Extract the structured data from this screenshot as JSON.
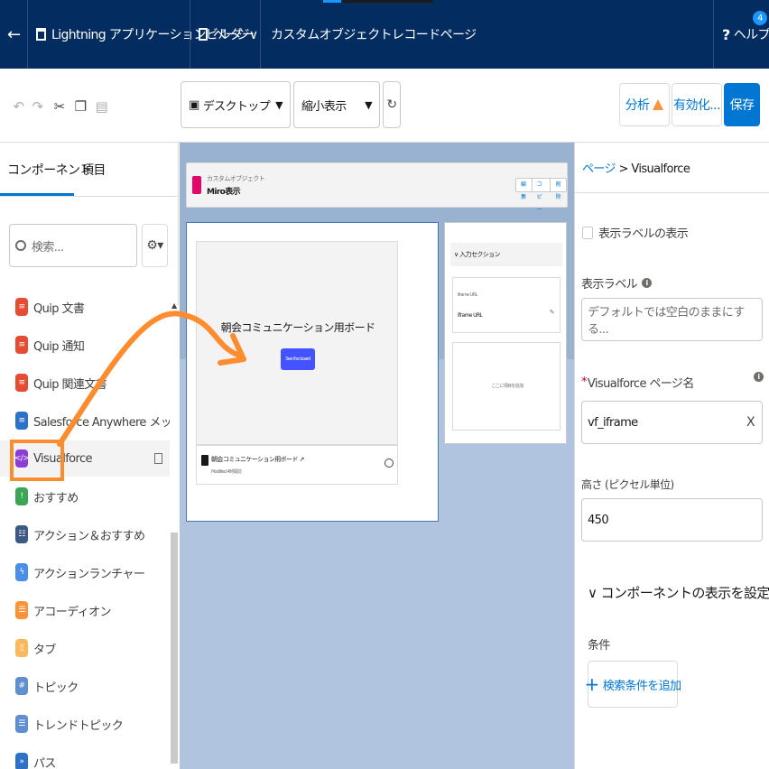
{
  "topbar": {
    "back_icon": "←",
    "builder_title": "Lightning アプリケーションビルダー",
    "pages_label": "ページ∨",
    "page_name": "カスタムオブジェクトレコードページ",
    "help_icon": "?",
    "help_label": "ヘルプ",
    "help_badge": "4"
  },
  "toolbar": {
    "undo_icon": "↶",
    "redo_icon": "↷",
    "cut_icon": "✂",
    "copy_icon": "❐",
    "paste_icon": "▤",
    "device_select": "デスクトップ",
    "device_icon": "▣",
    "view_select": "縮小表示",
    "refresh_icon": "↻",
    "analyze_label": "分析",
    "activate_label": "有効化...",
    "save_label": "保存"
  },
  "left_panel": {
    "tab_components": "コンポーネント",
    "tab_fields": "項目",
    "search_placeholder": "検索...",
    "gear_icon": "⚙▾",
    "scroll_up_icon": "▲",
    "components": [
      {
        "label": "Quip 文書",
        "icon": "quip-icon",
        "color": "#e44c34",
        "glyph": "≡"
      },
      {
        "label": "Quip 通知",
        "icon": "quip-icon",
        "color": "#e44c34",
        "glyph": "≡"
      },
      {
        "label": "Quip 関連文書",
        "icon": "quip-icon",
        "color": "#e44c34",
        "glyph": "≡"
      },
      {
        "label": "Salesforce Anywhere メッセージ",
        "icon": "message-icon",
        "color": "#2e72c7",
        "glyph": "≡"
      },
      {
        "label": "Visualforce",
        "icon": "visualforce-icon",
        "color": "#8b3dd6",
        "glyph": "</>"
      },
      {
        "label": "おすすめ",
        "icon": "recommendation-icon",
        "color": "#3ba755",
        "glyph": "!"
      },
      {
        "label": "アクション＆おすすめ",
        "icon": "action-icon",
        "color": "#3d5a85",
        "glyph": "☷"
      },
      {
        "label": "アクションランチャー",
        "icon": "launcher-icon",
        "color": "#4b8ee8",
        "glyph": "ϟ"
      },
      {
        "label": "アコーディオン",
        "icon": "accordion-icon",
        "color": "#fe9339",
        "glyph": "☰"
      },
      {
        "label": "タブ",
        "icon": "tabs-icon",
        "color": "#fcb95b",
        "glyph": "▯"
      },
      {
        "label": "トピック",
        "icon": "topic-icon",
        "color": "#5f8fd1",
        "glyph": "#"
      },
      {
        "label": "トレンドトピック",
        "icon": "trending-icon",
        "color": "#5f8fd1",
        "glyph": "☰"
      },
      {
        "label": "パス",
        "icon": "path-icon",
        "color": "#2e72c7",
        "glyph": "»"
      }
    ]
  },
  "canvas": {
    "object_type": "カスタムオブジェクト",
    "record_name": "Miro表示",
    "header_buttons": [
      "編集",
      "コピー",
      "削除"
    ],
    "vf_title": "朝会コミュニケーション用ボード",
    "vf_button": "See the board",
    "vf_footer_title": "朝会コミュニケーション用ボード ↗",
    "vf_footer_sub": "Modified 4時間前",
    "side_section": "∨ 入力セクション",
    "side_field_label": "iframe URL",
    "side_field_value": "iframe URL",
    "side_drop_text": "ここに項目を追加"
  },
  "right_panel": {
    "breadcrumb_link": "ページ",
    "breadcrumb_sep": " > ",
    "breadcrumb_current": "Visualforce",
    "show_label_checkbox": "表示ラベルの表示",
    "label_field": "表示ラベル",
    "label_placeholder": "デフォルトでは空白のままにする...",
    "vf_page_field": "Visualforce ページ名",
    "vf_page_value": "vf_iframe",
    "clear_icon": "X",
    "height_field": "高さ (ピクセル単位)",
    "height_value": "450",
    "visibility_section": "∨ コンポーネントの表示を設定",
    "conditions_label": "条件",
    "add_condition_button": "検索条件を追加"
  }
}
